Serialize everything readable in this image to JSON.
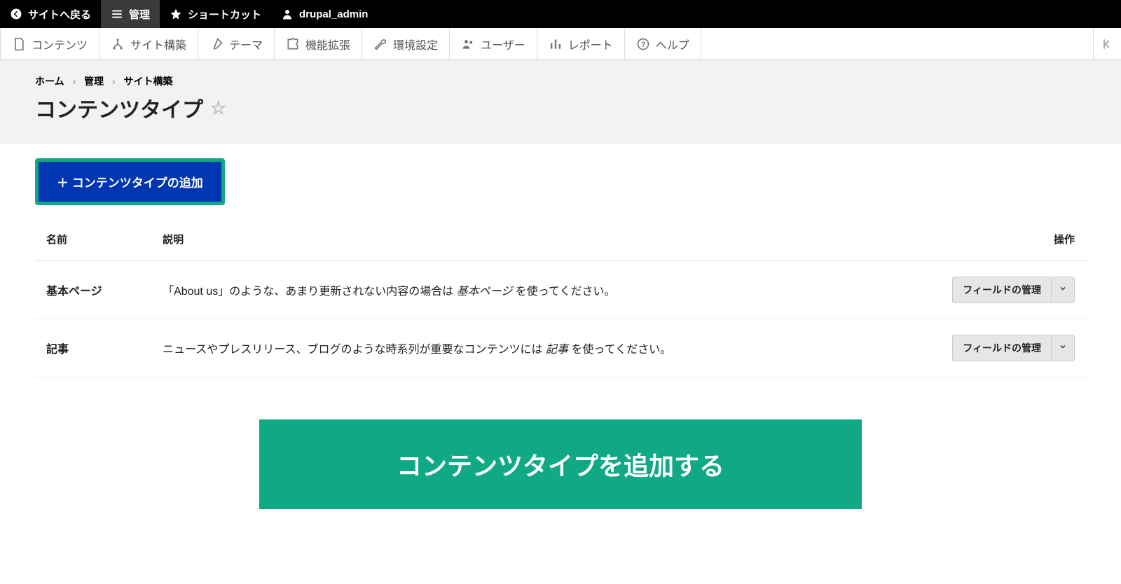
{
  "topbar": {
    "back": "サイトへ戻る",
    "manage": "管理",
    "shortcut": "ショートカット",
    "user": "drupal_admin"
  },
  "adminbar": {
    "items": [
      "コンテンツ",
      "サイト構築",
      "テーマ",
      "機能拡張",
      "環境設定",
      "ユーザー",
      "レポート",
      "ヘルプ"
    ]
  },
  "breadcrumb": {
    "home": "ホーム",
    "manage": "管理",
    "structure": "サイト構築"
  },
  "page_title": "コンテンツタイプ",
  "add_button": "＋ コンテンツタイプの追加",
  "columns": {
    "name": "名前",
    "desc": "説明",
    "ops": "操作"
  },
  "rows": [
    {
      "name": "基本ページ",
      "desc_pre": "「About us」のような、あまり更新されない内容の場合は ",
      "desc_em": "基本ページ",
      "desc_post": " を使ってください。",
      "op": "フィールドの管理"
    },
    {
      "name": "記事",
      "desc_pre": "ニュースやプレスリリース、ブログのような時系列が重要なコンテンツには ",
      "desc_em": "記事",
      "desc_post": " を使ってください。",
      "op": "フィールドの管理"
    }
  ],
  "banner": "コンテンツタイプを追加する"
}
